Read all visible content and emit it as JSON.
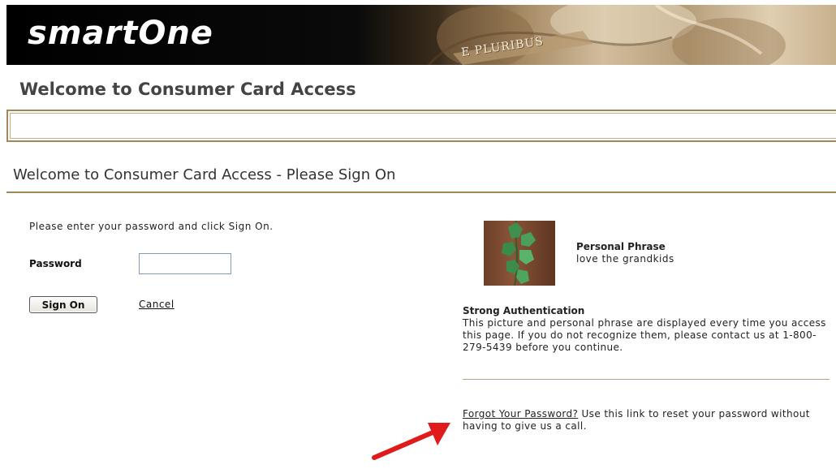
{
  "header": {
    "logo": "smartOne",
    "banner_motto": "E PLURIBUS"
  },
  "page_title": "Welcome to Consumer Card Access",
  "section_title": "Welcome to Consumer Card Access - Please Sign On",
  "signin": {
    "instruction": "Please enter your password and click Sign On.",
    "password_label": "Password",
    "password_value": "",
    "sign_on_label": "Sign On",
    "cancel_label": "Cancel"
  },
  "personal_phrase": {
    "title": "Personal Phrase",
    "text": "love the grandkids"
  },
  "strong_auth": {
    "title": "Strong Authentication",
    "text": "This picture and personal phrase are displayed every time you access this page. If you do not recognize them, please contact us at 1-800-279-5439 before you continue."
  },
  "forgot": {
    "link_label": "Forgot Your Password?",
    "text": " Use this link to reset your password without having to give us a call."
  },
  "colors": {
    "accent_rule": "#a4865b",
    "arrow": "#e01b1b"
  }
}
